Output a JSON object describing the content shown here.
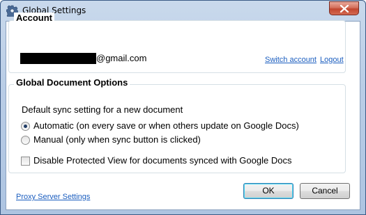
{
  "window": {
    "title": "Global Settings",
    "icon": "gear-icon",
    "close_icon": "close-icon"
  },
  "account": {
    "group_title": "Account",
    "email_domain": "@gmail.com",
    "switch_account_label": "Switch account",
    "logout_label": "Logout"
  },
  "document_options": {
    "group_title": "Global Document Options",
    "sync_setting_label": "Default sync setting for a new document",
    "automatic_label": "Automatic (on every save or when others update on Google Docs)",
    "manual_label": "Manual (only when sync button is clicked)",
    "selected_option": "Automatic",
    "disable_protected_view_label": "Disable Protected View for documents synced with Google Docs",
    "disable_protected_view_checked": false
  },
  "footer": {
    "proxy_settings_label": "Proxy Server Settings",
    "ok_label": "OK",
    "cancel_label": "Cancel"
  },
  "colors": {
    "link": "#1a5dbf",
    "titlebar": "#b9cde6",
    "close_button": "#c2462f"
  }
}
